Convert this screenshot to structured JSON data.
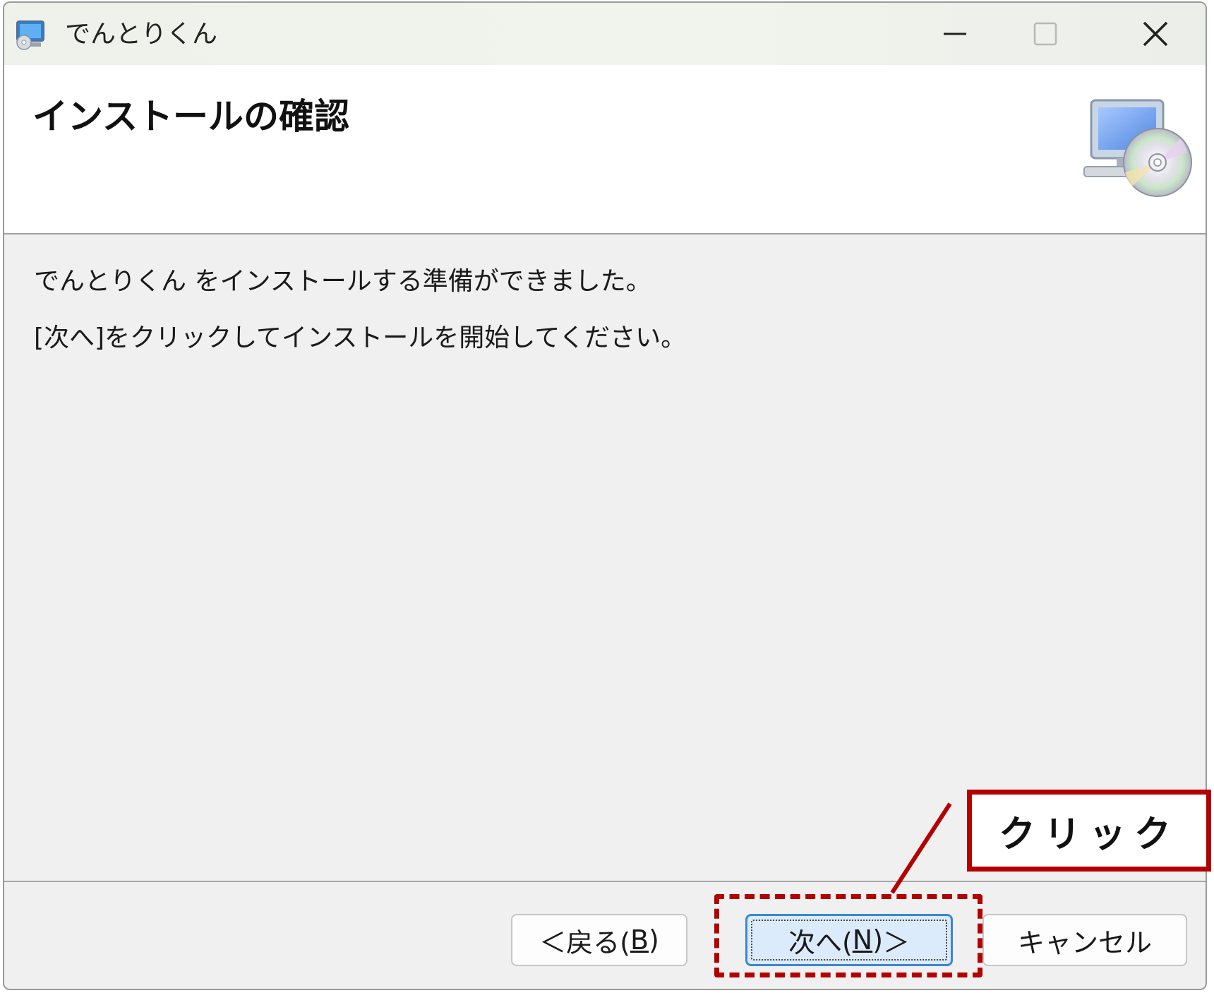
{
  "window": {
    "title": "でんとりくん",
    "controls": {
      "minimize": "minimize-icon",
      "maximize": "maximize-icon",
      "close": "close-icon"
    }
  },
  "header": {
    "title": "インストールの確認",
    "art": "computer-cd-icon"
  },
  "content": {
    "line1": "でんとりくん をインストールする準備ができました。",
    "line2": "[次へ]をクリックしてインストールを開始してください。"
  },
  "buttons": {
    "back_arrow": "＜",
    "back_text": "戻る(",
    "back_key": "B",
    "back_close": ")",
    "next_text": "次へ(",
    "next_key": "N",
    "next_close": ")",
    "next_arrow": "＞",
    "cancel": "キャンセル"
  },
  "annotation": {
    "callout": "クリック",
    "color": "#b30000"
  }
}
